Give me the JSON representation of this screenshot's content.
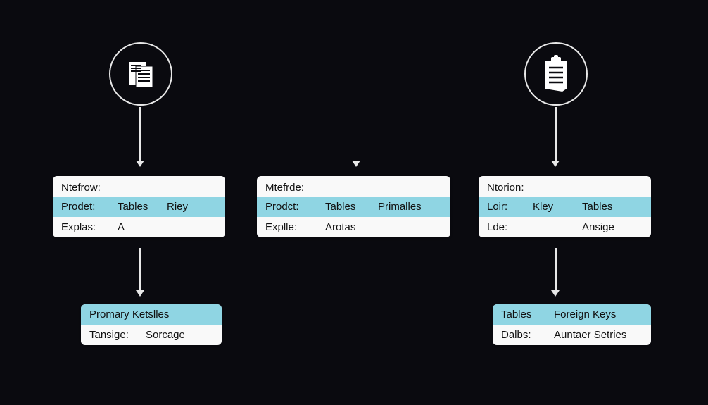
{
  "left_icon": "documents-icon",
  "right_icon": "clipboard-icon",
  "card_a": {
    "title": "Ntefrow:",
    "header": [
      "Prodet:",
      "Tables",
      "Riey"
    ],
    "row": [
      "Explas:",
      "A",
      ""
    ]
  },
  "card_b": {
    "title": "Mtefrde:",
    "header": [
      "Prodct:",
      "Tables",
      "Primalles"
    ],
    "row": [
      "Explle:",
      "Arotas",
      ""
    ]
  },
  "card_c": {
    "title": "Ntorion:",
    "header": [
      "Loir:",
      "Kley",
      "Tables"
    ],
    "row": [
      "Lde:",
      "",
      "Ansige"
    ]
  },
  "card_d": {
    "header": [
      "Promary Ketslles"
    ],
    "row": [
      "Tansige:",
      "Sorcage"
    ]
  },
  "card_e": {
    "header": [
      "Tables",
      "Foreign Keys"
    ],
    "row": [
      "Dalbs:",
      "Auntaer Setries"
    ]
  }
}
